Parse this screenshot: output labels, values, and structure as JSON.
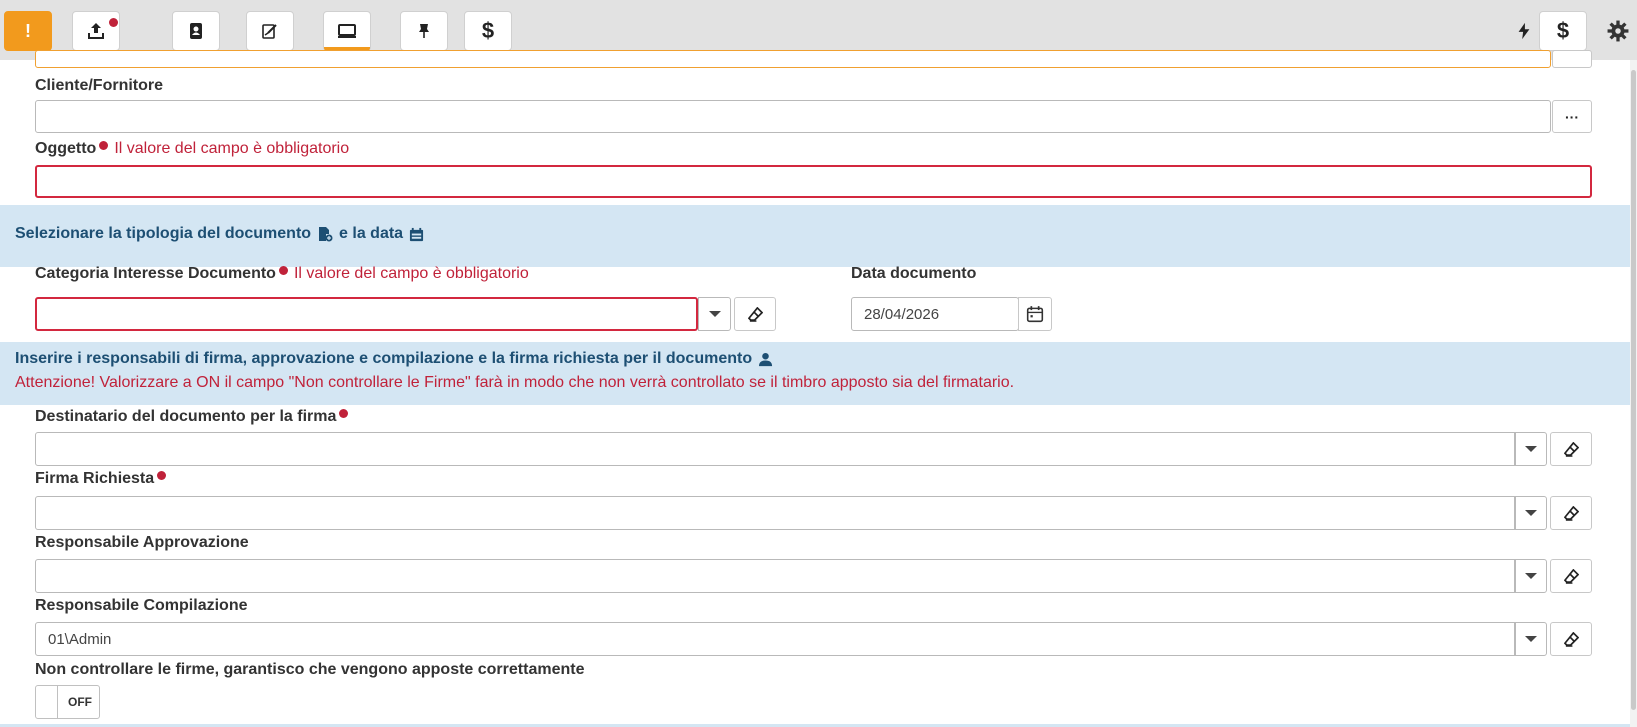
{
  "toolbar": {
    "alert_label": "!",
    "right_currency_symbol": "$",
    "currency_symbol": "$"
  },
  "form": {
    "cliente_label": "Cliente/Fornitore",
    "cliente_value": "",
    "more_button_label": "···",
    "oggetto_label": "Oggetto",
    "required_error": "Il valore del campo è obbligatorio",
    "oggetto_value": "",
    "section_tipologia": {
      "title_part1": "Selezionare la tipologia del documento",
      "title_part2": "e la data"
    },
    "categoria_label": "Categoria Interesse Documento",
    "categoria_value": "",
    "data_label": "Data documento",
    "data_value": "28/04/2026",
    "section_responsabili": {
      "title": "Inserire i responsabili di firma, approvazione e compilazione e la firma richiesta per il documento",
      "warning": "Attenzione! Valorizzare a ON il campo \"Non controllare le Firme\" farà in modo che non verrà controllato se il timbro apposto sia del firmatario."
    },
    "destinatario_label": "Destinatario del documento per la firma",
    "destinatario_value": "",
    "firma_label": "Firma Richiesta",
    "firma_value": "",
    "approvazione_label": "Responsabile Approvazione",
    "approvazione_value": "",
    "compilazione_label": "Responsabile Compilazione",
    "compilazione_value": "01\\Admin",
    "non_controllare_label": "Non controllare le firme, garantisco che vengono apposte correttamente",
    "toggle_state": "OFF"
  },
  "colors": {
    "accent": "#f29a1d",
    "error": "#c0223a",
    "band": "#d4e6f3",
    "band_text": "#1d4f73"
  }
}
